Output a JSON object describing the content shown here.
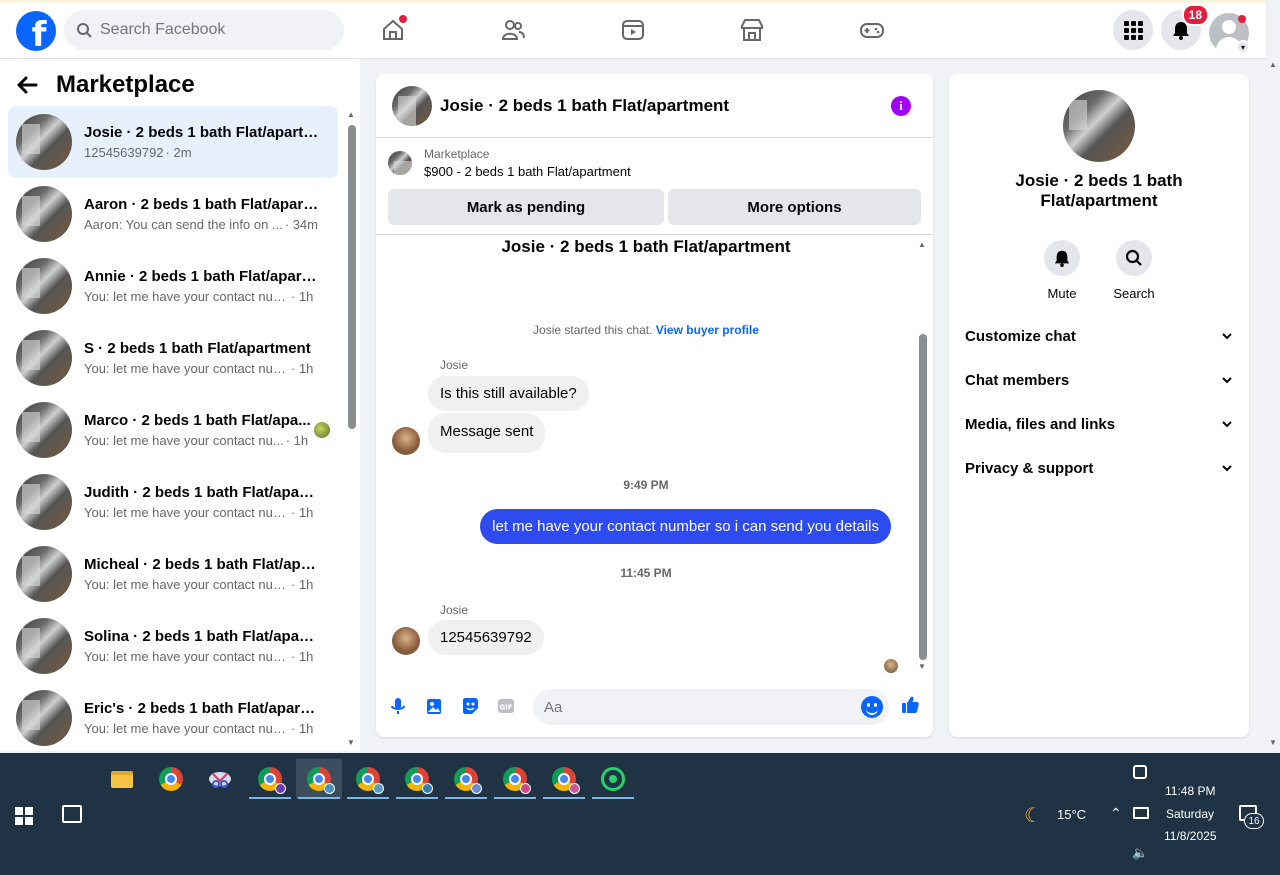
{
  "topbar": {
    "logo_letter": "f",
    "search_placeholder": "Search Facebook",
    "notifications_count": "18",
    "brand_color": "#0866ff"
  },
  "sidebar": {
    "title": "Marketplace",
    "threads": [
      {
        "name": "Josie · 2 beds 1 bath Flat/apartm...",
        "message": "12545639792",
        "time": "· 2m",
        "active": true
      },
      {
        "name": "Aaron · 2 beds 1 bath Flat/apart...",
        "message": "Aaron: You can send the info on ...",
        "time": "· 34m"
      },
      {
        "name": "Annie · 2 beds 1 bath Flat/apart...",
        "message": "You: let me have your contact num...",
        "time": "· 1h"
      },
      {
        "name": "S · 2 beds 1 bath Flat/apartment",
        "message": "You: let me have your contact num...",
        "time": "· 1h"
      },
      {
        "name": "Marco · 2 beds 1 bath Flat/apa...",
        "message": "You: let me have your contact nu...",
        "time": "· 1h"
      },
      {
        "name": "Judith · 2 beds 1 bath Flat/apart...",
        "message": "You: let me have your contact num...",
        "time": "· 1h"
      },
      {
        "name": "Micheal · 2 beds 1 bath Flat/apar...",
        "message": "You: let me have your contact num...",
        "time": "· 1h"
      },
      {
        "name": "Solina · 2 beds 1 bath Flat/apart...",
        "message": "You: let me have your contact num...",
        "time": "· 1h"
      },
      {
        "name": "Eric's · 2 beds 1 bath Flat/apartm...",
        "message": "You: let me have your contact num...",
        "time": "· 1h"
      }
    ]
  },
  "chat": {
    "header_title": "Josie · 2 beds 1 bath Flat/apartment",
    "listing_source": "Marketplace",
    "listing_price": "$900 - 2 beds 1 bath Flat/apartment",
    "btn_pending": "Mark as pending",
    "btn_more": "More options",
    "conversation_title": "Josie · 2 beds 1 bath Flat/apartment",
    "started_text": "Josie started this chat.",
    "buyer_profile_link": "View buyer profile",
    "sender_1": "Josie",
    "msg_1": "Is this still available?",
    "msg_2": "Message sent",
    "time_1": "9:49 PM",
    "msg_out": "let me have your contact number so i can send you details",
    "time_2": "11:45 PM",
    "sender_2": "Josie",
    "msg_3": "12545639792",
    "input_placeholder": "Aa",
    "outgoing_color": "#2e4bf0"
  },
  "details": {
    "name": "Josie · 2 beds 1 bath Flat/apartment",
    "mute_label": "Mute",
    "search_label": "Search",
    "rows": [
      "Customize chat",
      "Chat members",
      "Media, files and links",
      "Privacy & support"
    ]
  },
  "taskbar": {
    "weather": "15°C",
    "time": "11:48 PM",
    "day": "Saturday",
    "date": "11/8/2025",
    "notif_count": "16"
  }
}
